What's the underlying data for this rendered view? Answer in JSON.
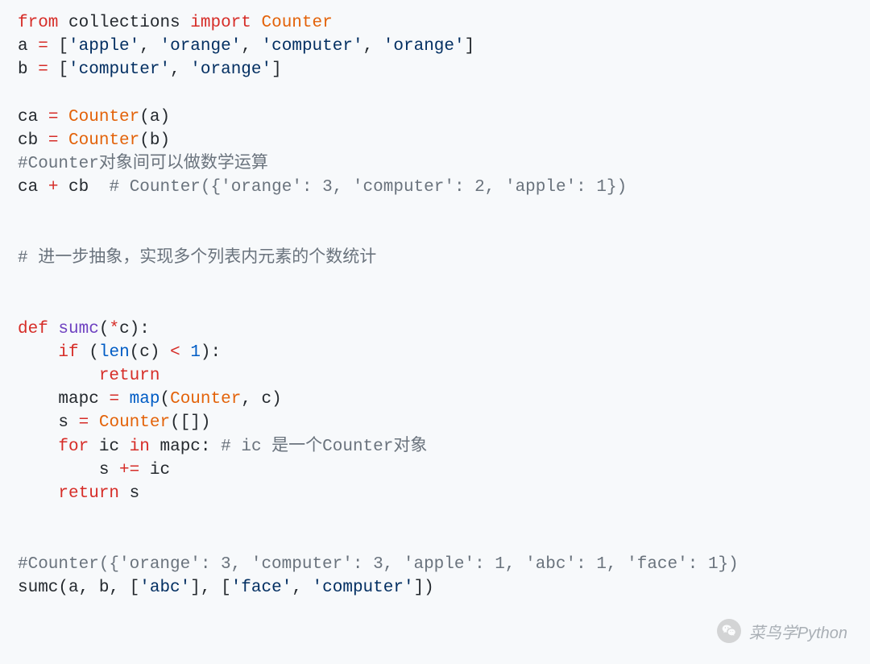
{
  "code": {
    "lines": [
      [
        {
          "t": "from",
          "c": "kw"
        },
        {
          "t": " ",
          "c": "name"
        },
        {
          "t": "collections",
          "c": "name"
        },
        {
          "t": " ",
          "c": "name"
        },
        {
          "t": "import",
          "c": "kw"
        },
        {
          "t": " ",
          "c": "name"
        },
        {
          "t": "Counter",
          "c": "class"
        }
      ],
      [
        {
          "t": "a",
          "c": "name"
        },
        {
          "t": " ",
          "c": "name"
        },
        {
          "t": "=",
          "c": "op"
        },
        {
          "t": " [",
          "c": "punct"
        },
        {
          "t": "'apple'",
          "c": "str"
        },
        {
          "t": ", ",
          "c": "punct"
        },
        {
          "t": "'orange'",
          "c": "str"
        },
        {
          "t": ", ",
          "c": "punct"
        },
        {
          "t": "'computer'",
          "c": "str"
        },
        {
          "t": ", ",
          "c": "punct"
        },
        {
          "t": "'orange'",
          "c": "str"
        },
        {
          "t": "]",
          "c": "punct"
        }
      ],
      [
        {
          "t": "b",
          "c": "name"
        },
        {
          "t": " ",
          "c": "name"
        },
        {
          "t": "=",
          "c": "op"
        },
        {
          "t": " [",
          "c": "punct"
        },
        {
          "t": "'computer'",
          "c": "str"
        },
        {
          "t": ", ",
          "c": "punct"
        },
        {
          "t": "'orange'",
          "c": "str"
        },
        {
          "t": "]",
          "c": "punct"
        }
      ],
      [],
      [
        {
          "t": "ca",
          "c": "name"
        },
        {
          "t": " ",
          "c": "name"
        },
        {
          "t": "=",
          "c": "op"
        },
        {
          "t": " ",
          "c": "name"
        },
        {
          "t": "Counter",
          "c": "class"
        },
        {
          "t": "(a)",
          "c": "punct"
        }
      ],
      [
        {
          "t": "cb",
          "c": "name"
        },
        {
          "t": " ",
          "c": "name"
        },
        {
          "t": "=",
          "c": "op"
        },
        {
          "t": " ",
          "c": "name"
        },
        {
          "t": "Counter",
          "c": "class"
        },
        {
          "t": "(b)",
          "c": "punct"
        }
      ],
      [
        {
          "t": "#Counter对象间可以做数学运算",
          "c": "comment"
        }
      ],
      [
        {
          "t": "ca",
          "c": "name"
        },
        {
          "t": " ",
          "c": "name"
        },
        {
          "t": "+",
          "c": "op"
        },
        {
          "t": " ",
          "c": "name"
        },
        {
          "t": "cb",
          "c": "name"
        },
        {
          "t": "  ",
          "c": "name"
        },
        {
          "t": "# Counter({'orange': 3, 'computer': 2, 'apple': 1})",
          "c": "comment"
        }
      ],
      [],
      [],
      [
        {
          "t": "# 进一步抽象，实现多个列表内元素的个数统计",
          "c": "comment"
        }
      ],
      [],
      [],
      [
        {
          "t": "def",
          "c": "kw"
        },
        {
          "t": " ",
          "c": "name"
        },
        {
          "t": "sumc",
          "c": "def"
        },
        {
          "t": "(",
          "c": "punct"
        },
        {
          "t": "*",
          "c": "op"
        },
        {
          "t": "c",
          "c": "name"
        },
        {
          "t": "):",
          "c": "punct"
        }
      ],
      [
        {
          "t": "    ",
          "c": "name"
        },
        {
          "t": "if",
          "c": "kw"
        },
        {
          "t": " (",
          "c": "punct"
        },
        {
          "t": "len",
          "c": "builtin"
        },
        {
          "t": "(c)",
          "c": "punct"
        },
        {
          "t": " ",
          "c": "name"
        },
        {
          "t": "<",
          "c": "op"
        },
        {
          "t": " ",
          "c": "name"
        },
        {
          "t": "1",
          "c": "num"
        },
        {
          "t": "):",
          "c": "punct"
        }
      ],
      [
        {
          "t": "        ",
          "c": "name"
        },
        {
          "t": "return",
          "c": "kw"
        }
      ],
      [
        {
          "t": "    ",
          "c": "name"
        },
        {
          "t": "mapc",
          "c": "name"
        },
        {
          "t": " ",
          "c": "name"
        },
        {
          "t": "=",
          "c": "op"
        },
        {
          "t": " ",
          "c": "name"
        },
        {
          "t": "map",
          "c": "builtin"
        },
        {
          "t": "(",
          "c": "punct"
        },
        {
          "t": "Counter",
          "c": "class"
        },
        {
          "t": ", c)",
          "c": "punct"
        }
      ],
      [
        {
          "t": "    ",
          "c": "name"
        },
        {
          "t": "s",
          "c": "name"
        },
        {
          "t": " ",
          "c": "name"
        },
        {
          "t": "=",
          "c": "op"
        },
        {
          "t": " ",
          "c": "name"
        },
        {
          "t": "Counter",
          "c": "class"
        },
        {
          "t": "([])",
          "c": "punct"
        }
      ],
      [
        {
          "t": "    ",
          "c": "name"
        },
        {
          "t": "for",
          "c": "kw"
        },
        {
          "t": " ",
          "c": "name"
        },
        {
          "t": "ic",
          "c": "name"
        },
        {
          "t": " ",
          "c": "name"
        },
        {
          "t": "in",
          "c": "kw"
        },
        {
          "t": " ",
          "c": "name"
        },
        {
          "t": "mapc",
          "c": "name"
        },
        {
          "t": ": ",
          "c": "punct"
        },
        {
          "t": "# ic 是一个Counter对象",
          "c": "comment"
        }
      ],
      [
        {
          "t": "        ",
          "c": "name"
        },
        {
          "t": "s",
          "c": "name"
        },
        {
          "t": " ",
          "c": "name"
        },
        {
          "t": "+=",
          "c": "op"
        },
        {
          "t": " ",
          "c": "name"
        },
        {
          "t": "ic",
          "c": "name"
        }
      ],
      [
        {
          "t": "    ",
          "c": "name"
        },
        {
          "t": "return",
          "c": "kw"
        },
        {
          "t": " ",
          "c": "name"
        },
        {
          "t": "s",
          "c": "name"
        }
      ],
      [],
      [],
      [
        {
          "t": "#Counter({'orange': 3, 'computer': 3, 'apple': 1, 'abc': 1, 'face': 1})",
          "c": "comment"
        }
      ],
      [
        {
          "t": "sumc",
          "c": "name"
        },
        {
          "t": "(a, b, [",
          "c": "punct"
        },
        {
          "t": "'abc'",
          "c": "str"
        },
        {
          "t": "], [",
          "c": "punct"
        },
        {
          "t": "'face'",
          "c": "str"
        },
        {
          "t": ", ",
          "c": "punct"
        },
        {
          "t": "'computer'",
          "c": "str"
        },
        {
          "t": "])",
          "c": "punct"
        }
      ]
    ]
  },
  "watermark": {
    "text": "菜鸟学Python"
  }
}
